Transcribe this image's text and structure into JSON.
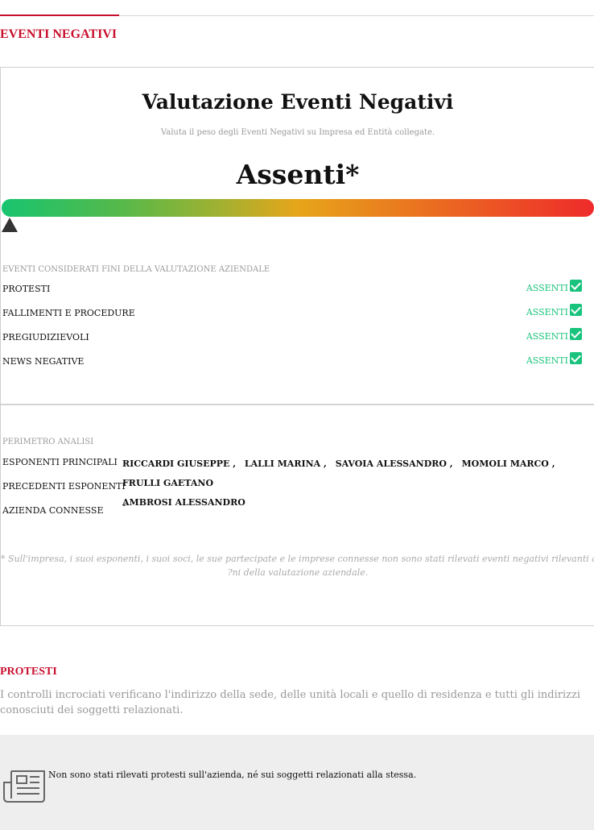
{
  "section": {
    "title": "EVENTI NEGATIVI"
  },
  "card": {
    "title": "Valutazione Eventi Negativi",
    "subtitle": "Valuta il peso degli Eventi Negativi su Impresa ed Entità collegate.",
    "result": "Assenti*",
    "gauge_level": 0,
    "colors": {
      "accent": "#c8102e",
      "ok": "#19c37d",
      "gauge_start": "#18c46f",
      "gauge_mid": "#e7a51a",
      "gauge_end": "#ee2b2b"
    }
  },
  "events": {
    "caption": "EVENTI CONSIDERATI FINI DELLA VALUTAZIONE AZIENDALE",
    "items": [
      {
        "label": "PROTESTI",
        "status": "ASSENTI",
        "icon": "check-icon"
      },
      {
        "label": "FALLIMENTI E PROCEDURE",
        "status": "ASSENTI",
        "icon": "check-icon"
      },
      {
        "label": "PREGIUDIZIEVOLI",
        "status": "ASSENTI",
        "icon": "check-icon"
      },
      {
        "label": "NEWS NEGATIVE",
        "status": "ASSENTI",
        "icon": "check-icon"
      }
    ]
  },
  "perimeter": {
    "caption": "PERIMETRO ANALISI",
    "labels": [
      "ESPONENTI PRINCIPALI",
      "PRECEDENTI ESPONENTI",
      "AZIENDA CONNESSE"
    ],
    "names": [
      "RICCARDI GIUSEPPE ,",
      "LALLI MARINA ,",
      "SAVOIA ALESSANDRO ,",
      "MOMOLI MARCO ,",
      "FRULLI GAETANO",
      "AMBROSI ALESSANDRO"
    ],
    "connected": "-"
  },
  "footnote": {
    "line1": "* Sull'impresa, i suoi esponenti, i suoi soci, le sue partecipate e le imprese connesse non sono stati rilevati eventi negativi rilevanti ai",
    "line2": "?ni della valutazione aziendale."
  },
  "protesti": {
    "title": "PROTESTI",
    "description": "I controlli incrociati verificano l'indirizzo della sede, delle unità locali e quello di residenza e tutti gli indirizzi conosciuti dei soggetti relazionati.",
    "info_icon": "newspaper-icon",
    "info_text": "Non sono stati rilevati protesti sull'azienda, né sui soggetti relazionati alla stessa."
  }
}
